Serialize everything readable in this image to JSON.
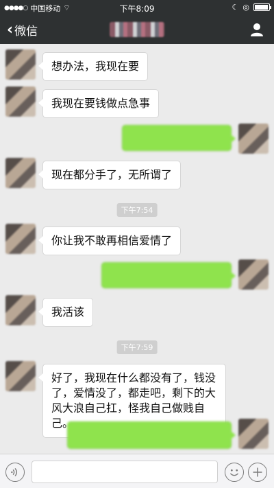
{
  "status_bar": {
    "carrier": "中国移动",
    "time": "下午8:09",
    "signal_dots": "●●●●○"
  },
  "nav": {
    "back_label": "微信",
    "chat_title": ""
  },
  "messages": [
    {
      "side": "left",
      "text": "想办法，我现在要"
    },
    {
      "side": "left",
      "text": "我现在要钱做点急事"
    },
    {
      "side": "right",
      "text": ""
    },
    {
      "side": "left",
      "text": "现在都分手了，无所谓了"
    },
    {
      "type": "timestamp",
      "text": "下午7:54"
    },
    {
      "side": "left",
      "text": "你让我不敢再相信爱情了"
    },
    {
      "side": "right",
      "text": ""
    },
    {
      "side": "left",
      "text": "我活该"
    },
    {
      "type": "timestamp",
      "text": "下午7:59"
    },
    {
      "side": "left",
      "text": "好了，我现在什么都没有了，钱没了，爱情没了，都走吧，剩下的大风大浪自己扛，怪我自己做贱自己。"
    },
    {
      "side": "right",
      "text": ""
    }
  ],
  "input_bar": {
    "placeholder": ""
  },
  "icons": {
    "back": "chevron-left-icon",
    "profile": "person-icon",
    "voice": "voice-icon",
    "emoji": "emoji-icon",
    "plus": "plus-icon"
  }
}
